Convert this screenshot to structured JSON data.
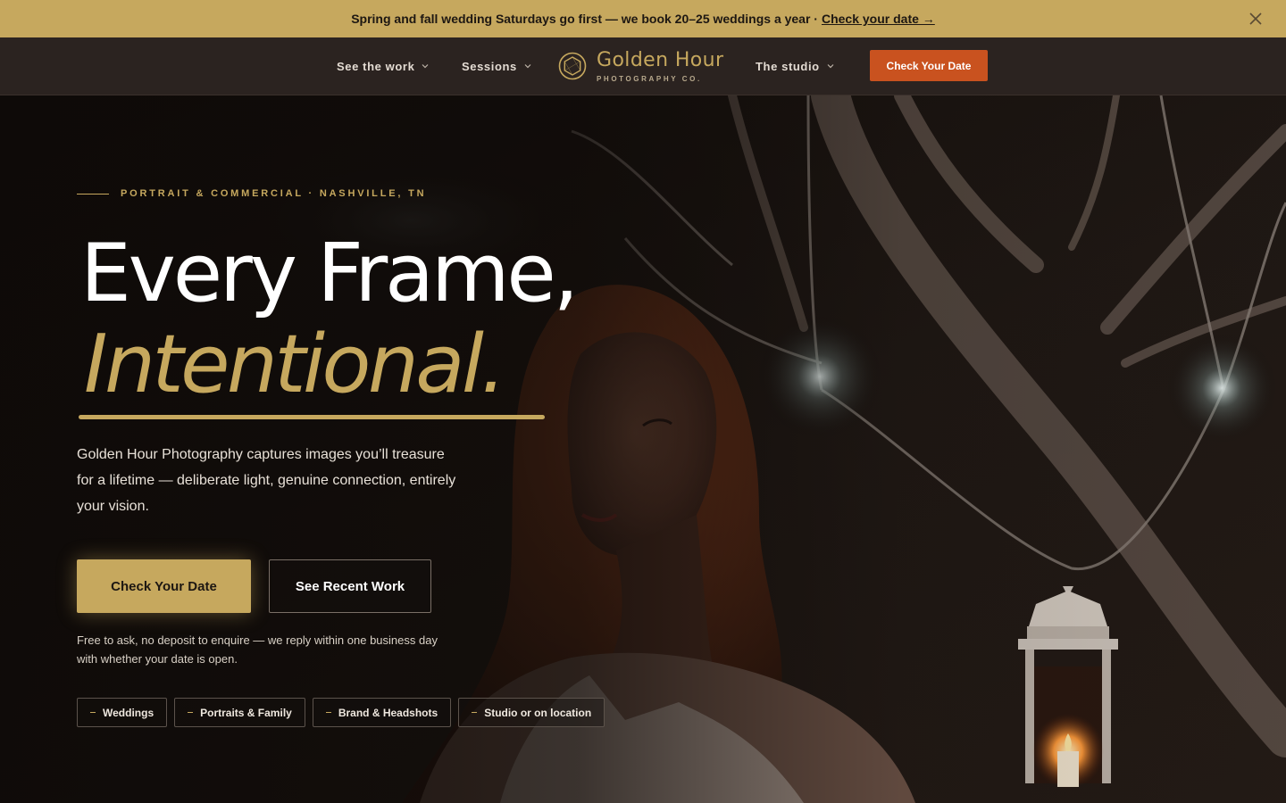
{
  "announcement": {
    "text": "Spring and fall wedding Saturdays go first — we book 20–25 weddings a year ·",
    "link": "Check your date →"
  },
  "nav": {
    "items": [
      {
        "label": "See the work"
      },
      {
        "label": "Sessions"
      },
      {
        "label": "The studio"
      }
    ],
    "cta": "Check Your Date"
  },
  "brand": {
    "name": "Golden Hour",
    "tagline": "PHOTOGRAPHY CO."
  },
  "hero": {
    "eyebrow": "PORTRAIT & COMMERCIAL · NASHVILLE, TN",
    "headline_1": "Every Frame,",
    "headline_2": "Intentional.",
    "lede": "Golden Hour Photography captures images you’ll treasure for a lifetime — deliberate light, genuine connection, entirely your vision.",
    "primary_cta": "Check Your Date",
    "secondary_cta": "See Recent Work",
    "fine_print": "Free to ask, no deposit to enquire — we reply within one business day with whether your date is open.",
    "tags": [
      {
        "label": "Weddings"
      },
      {
        "label": "Portraits & Family"
      },
      {
        "label": "Brand & Headshots"
      },
      {
        "label": "Studio or on location"
      }
    ]
  },
  "colors": {
    "gold": "#c6a85e",
    "cta_orange": "#c9521f",
    "header_bg": "#2b2320",
    "hero_bg": "#1a1512"
  },
  "icons": {
    "close": "close-icon",
    "chevron": "chevron-down-icon",
    "logo": "aperture-icon"
  }
}
